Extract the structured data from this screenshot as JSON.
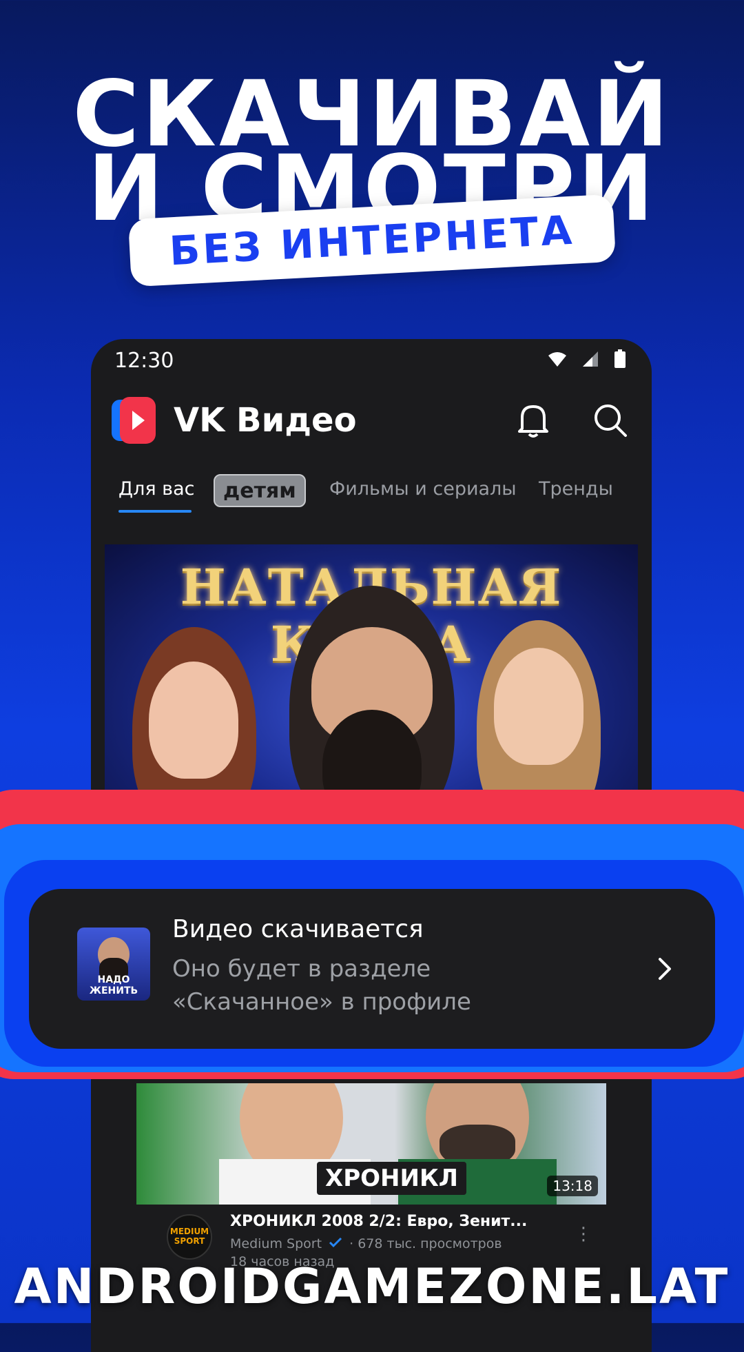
{
  "headline": {
    "line1": "СКАЧИВАЙ",
    "line2": "И СМОТРИ",
    "pill": "БЕЗ ИНТЕРНЕТА"
  },
  "status_bar": {
    "time": "12:30"
  },
  "app_bar": {
    "title": "VK Видео"
  },
  "tabs": [
    {
      "label": "Для вас",
      "active": true
    },
    {
      "label": "детям"
    },
    {
      "label": "Фильмы и сериалы"
    },
    {
      "label": "Тренды"
    }
  ],
  "banner": {
    "title": "НАТАЛЬНАЯ КАРТА"
  },
  "toast": {
    "thumb_text": "НАДО ЖЕНИТЬ",
    "title": "Видео скачивается",
    "subtitle_line1": "Оно будет в разделе",
    "subtitle_line2": "«Скачанное» в профиле"
  },
  "video": {
    "brand": "ХРОНИКЛ",
    "duration": "13:18",
    "title": "ХРОНИКЛ 2008 2/2: Евро, Зенит...",
    "channel": "Medium Sport",
    "channel_avatar_text": "MEDIUM SPORT",
    "views": "· 678 тыс. просмотров",
    "time_ago": "18 часов назад"
  },
  "watermark": "ANDROIDGAMEZONE.LAT",
  "colors": {
    "accent_blue": "#1574ff",
    "accent_red": "#f2344a",
    "tab_underline": "#2787f5",
    "dark_surface": "#1b1b1d"
  }
}
